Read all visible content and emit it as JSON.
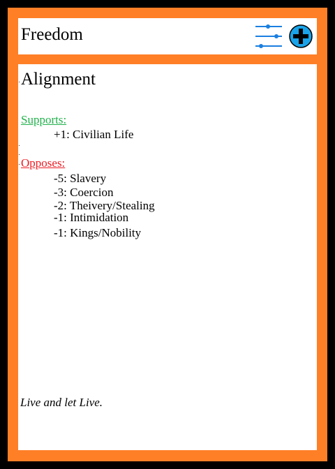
{
  "header": {
    "title": "Freedom"
  },
  "icons": {
    "settings": "sliders-icon",
    "add": "plus-circle-icon"
  },
  "colors": {
    "border": "#ff7f27",
    "supports": "#22b14c",
    "opposes": "#ed1c24",
    "icon_blue": "#1a7fe0"
  },
  "alignment": {
    "title": "Alignment",
    "supports_label": "Supports:",
    "supports": [
      "+1: Civilian Life"
    ],
    "opposes_label": "Opposes:",
    "opposes": [
      "-5: Slavery",
      "-3: Coercion",
      "-2: Theivery/Stealing",
      "-1: Intimidation",
      "-1: Kings/Nobility"
    ]
  },
  "motto": "Live and let Live."
}
